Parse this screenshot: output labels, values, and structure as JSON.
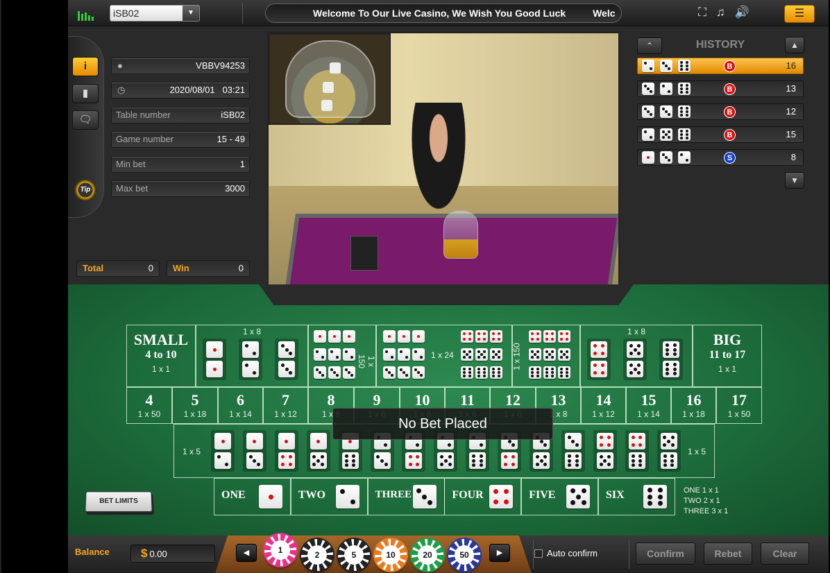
{
  "topbar": {
    "table_select": "iSB02",
    "marquee": "Welcome To Our Live Casino, We Wish You Good Luck          Welc",
    "icons": [
      "fullscreen-icon",
      "music-mute-icon",
      "sound-icon",
      "menu-icon"
    ]
  },
  "info": {
    "user_id": "VBBV94253",
    "datetime": "2020/08/01   03:21",
    "table_number_label": "Table number",
    "table_number": "iSB02",
    "game_number_label": "Game number",
    "game_number": "15 - 49",
    "min_bet_label": "Min bet",
    "min_bet": "1",
    "max_bet_label": "Max bet",
    "max_bet": "3000",
    "total_label": "Total",
    "total": "0",
    "win_label": "Win",
    "win": "0",
    "tip_label": "Tip"
  },
  "history": {
    "title": "HISTORY",
    "rows": [
      {
        "dice": [
          2,
          3,
          6
        ],
        "result": "B",
        "total": "16"
      },
      {
        "dice": [
          3,
          2,
          6
        ],
        "result": "B",
        "total": "13"
      },
      {
        "dice": [
          3,
          3,
          6
        ],
        "result": "B",
        "total": "12"
      },
      {
        "dice": [
          2,
          5,
          6
        ],
        "result": "B",
        "total": "15"
      },
      {
        "dice": [
          1,
          3,
          2
        ],
        "result": "S",
        "total": "8"
      }
    ]
  },
  "board": {
    "small_title": "SMALL",
    "small_range": "4 to 10",
    "small_odds": "1 x 1",
    "big_title": "BIG",
    "big_range": "11 to 17",
    "big_odds": "1 x 1",
    "double_odds": "1 x 8",
    "triple_odds": "1 x 150",
    "any_triple_odds": "1 x 24",
    "combo_odds": "1 x 5",
    "sums": [
      {
        "n": "4",
        "o": "1 x 50"
      },
      {
        "n": "5",
        "o": "1 x 18"
      },
      {
        "n": "6",
        "o": "1 x 14"
      },
      {
        "n": "7",
        "o": "1 x 12"
      },
      {
        "n": "8",
        "o": "1 x 8"
      },
      {
        "n": "9",
        "o": "1 x 6"
      },
      {
        "n": "10",
        "o": "1 x 6"
      },
      {
        "n": "11",
        "o": "1 x 6"
      },
      {
        "n": "12",
        "o": "1 x 6"
      },
      {
        "n": "13",
        "o": "1 x 8"
      },
      {
        "n": "14",
        "o": "1 x 12"
      },
      {
        "n": "15",
        "o": "1 x 14"
      },
      {
        "n": "16",
        "o": "1 x 18"
      },
      {
        "n": "17",
        "o": "1 x 50"
      }
    ],
    "singles": [
      "ONE",
      "TWO",
      "THREE",
      "FOUR",
      "FIVE",
      "SIX"
    ],
    "single_odds": [
      "ONE 1 x 1",
      "TWO 2 x 1",
      "THREE 3 x 1"
    ],
    "no_bet": "No Bet Placed",
    "bet_limits": "BET LIMITS"
  },
  "bottom": {
    "balance_label": "Balance",
    "currency": "$",
    "balance": "0.00",
    "chips": [
      {
        "v": "1",
        "color": "#e8338a"
      },
      {
        "v": "2",
        "color": "#222222"
      },
      {
        "v": "5",
        "color": "#222222"
      },
      {
        "v": "10",
        "color": "#e67e22"
      },
      {
        "v": "20",
        "color": "#1e9e4a"
      },
      {
        "v": "50",
        "color": "#2a3a9a"
      }
    ],
    "auto_confirm": "Auto confirm",
    "confirm": "Confirm",
    "rebet": "Rebet",
    "clear": "Clear"
  }
}
